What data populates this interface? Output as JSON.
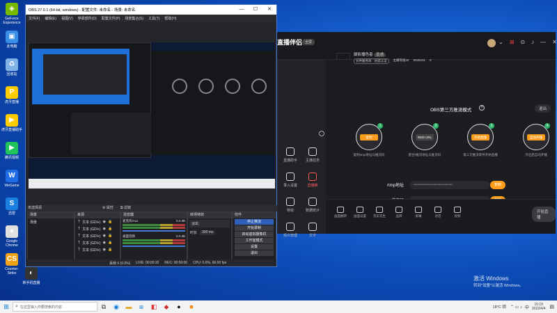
{
  "desktop": {
    "icons": [
      {
        "label": "GeForce Experience",
        "glyph": "◈",
        "bg": "#76b900"
      },
      {
        "label": "此电脑",
        "glyph": "▣",
        "bg": "#3a8ee6"
      },
      {
        "label": "回收站",
        "glyph": "♻",
        "bg": "#7fb2e6"
      },
      {
        "label": "虎牙直播",
        "glyph": "P",
        "bg": "#ffcc00"
      },
      {
        "label": "虎牙直播助手",
        "glyph": "▶",
        "bg": "#ffcc00"
      },
      {
        "label": "腾讯视频",
        "glyph": "▶",
        "bg": "#21c45a"
      },
      {
        "label": "WeGame",
        "glyph": "W",
        "bg": "#1e6de6"
      },
      {
        "label": "迅雷",
        "glyph": "S",
        "bg": "#1a7fe0"
      },
      {
        "label": "Google Chrome",
        "glyph": "●",
        "bg": "#e0e0e0"
      },
      {
        "label": "Counter-Strike",
        "glyph": "CS",
        "bg": "#f2a215"
      }
    ],
    "icon_extra": "新手机直播",
    "watermark_title": "激活 Windows",
    "watermark_sub": "转到\"设置\"以激活 Windows。"
  },
  "obs": {
    "title": "OBS 27.0.1 (64-bit, windows) - 配置文件: 未命名 - 场景: 未命名",
    "menu": [
      "文件(F)",
      "编辑(E)",
      "视图(V)",
      "停靠部件(D)",
      "配置文件(P)",
      "场景集合(S)",
      "工具(T)",
      "帮助(H)"
    ],
    "source_bar": "未选择源",
    "props_label": "属性",
    "filters_label": "滤镜",
    "docks": {
      "scenes": "场景",
      "sources": "来源",
      "mixer": "混音器",
      "transitions": "转场特效",
      "controls": "控件"
    },
    "scene_item": "场景",
    "sources": [
      "文本 (GDI+)",
      "文本 (GDI+)",
      "文本 (GDI+)",
      "文本 (GDI+)",
      "文本 (GDI+)"
    ],
    "mixer": [
      {
        "name": "麦克风/Aux",
        "db": "0.0 dB"
      },
      {
        "name": "桌面音频",
        "db": "0.0 dB"
      }
    ],
    "transition": {
      "type": "淡出",
      "duration_label": "时长",
      "duration": "300 ms"
    },
    "controls": [
      "停止推流",
      "开始录制",
      "启动虚拟摄像机",
      "工作室模式",
      "设置",
      "退出"
    ],
    "status": {
      "dropped": "丢帧 0 (0.0%)",
      "live": "LIVE: 00:00:32",
      "rec": "REC: 00:00:00",
      "cpu": "CPU: 0.6%, 60.00 fps",
      "speed": "kb/s: 0"
    }
  },
  "app": {
    "logo": "直播伴侣",
    "user_name": "颠影播色者",
    "user_tag": "普通",
    "user_sub": "文件服务商 · 达成认证",
    "sub_stat1": "主播等级32",
    "sub_stat2": "9025231",
    "sub_stat3": "0",
    "panel_title": "OBS第三方推流模式",
    "exit_label": "退出",
    "side_items": [
      "直播助手",
      "主播任务",
      "录入设置",
      "直播推",
      "特效",
      "数据统计",
      "观众管理",
      "文字"
    ],
    "steps": [
      {
        "num": "1",
        "btn": "复制",
        "title": "复制rtmp地址与推流码",
        "color": "#ff9c1a"
      },
      {
        "num": "2",
        "btn": "RMS URL",
        "title": "配合/推流地址与推流码",
        "color": "#444"
      },
      {
        "num": "3",
        "btn": "开始直播",
        "title": "第三方推流软件开始直播",
        "color": "#ff9c1a"
      },
      {
        "num": "4",
        "btn": "自动开播",
        "title": "开启后自动开播",
        "color": "#ff9c1a"
      }
    ],
    "rtmp_label": "rtmp地址",
    "rtmp_value": "••••••••••••••••••••••••••••••••",
    "key_label": "推流码",
    "key_value": "•••••••••••••••••",
    "copy_label": "复制",
    "hint": "开播后rtmp地址与推流码，下次无需重复填写",
    "tools": [
      "画面翻转",
      "画面设置",
      "音乐先生",
      "品牌",
      "屏幕",
      "语音",
      "视频"
    ],
    "start_label": "开始直播"
  },
  "taskbar": {
    "search_placeholder": "在这里输入你要搜索的内容",
    "weather": "18°C 阴",
    "ime": "中",
    "time": "15:19",
    "date": "2022/4/4"
  },
  "colors": {
    "accent": "#ff9c1a",
    "obs_bg": "#25262b",
    "app_bg": "#1c1d21"
  }
}
